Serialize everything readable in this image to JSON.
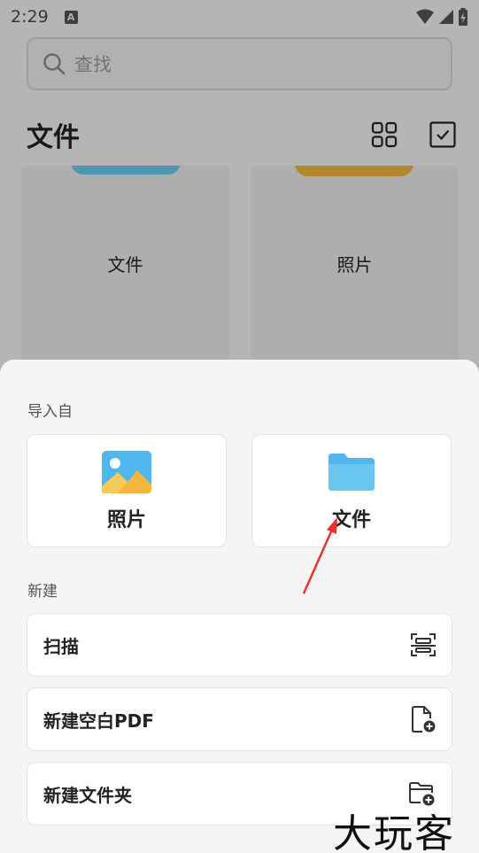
{
  "status": {
    "time": "2:29",
    "a_badge": "A"
  },
  "search": {
    "placeholder": "查找"
  },
  "files": {
    "title": "文件",
    "folders": [
      {
        "label": "文件",
        "color": "#6cc7f0"
      },
      {
        "label": "照片",
        "color": "#f2b43d"
      }
    ]
  },
  "sheet": {
    "import_label": "导入自",
    "import_options": [
      {
        "label": "照片",
        "icon": "photo-icon"
      },
      {
        "label": "文件",
        "icon": "folder-icon"
      }
    ],
    "new_label": "新建",
    "new_options": [
      {
        "label": "扫描",
        "icon": "scan-icon"
      },
      {
        "label": "新建空白PDF",
        "icon": "new-pdf-icon"
      },
      {
        "label": "新建文件夹",
        "icon": "new-folder-icon"
      }
    ]
  },
  "watermark": {
    "text": "大玩客"
  },
  "colors": {
    "accent_blue": "#4fb6ee",
    "accent_orange": "#f4b63c",
    "arrow_red": "#e8322b"
  }
}
